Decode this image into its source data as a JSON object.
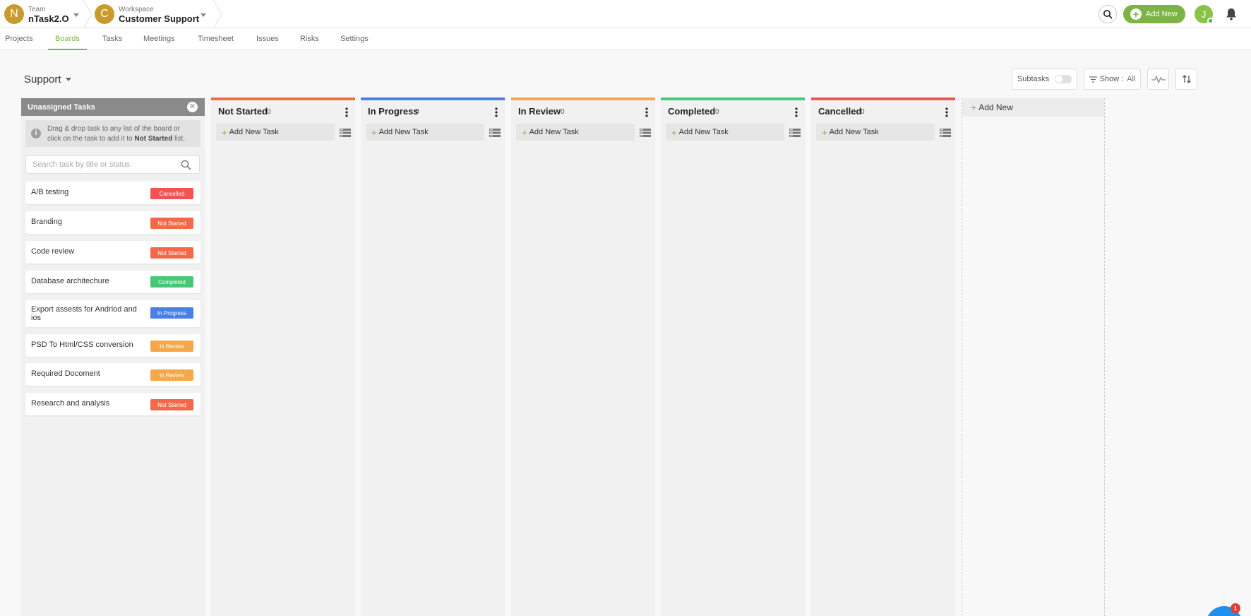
{
  "header": {
    "team": {
      "initial": "N",
      "caption": "Team",
      "name": "nTask2.O"
    },
    "workspace": {
      "initial": "C",
      "caption": "Workspace",
      "name": "Customer Support"
    },
    "add_new_label": "Add New",
    "user_initial": "J",
    "colors": {
      "accent": "#7cb342",
      "team_avatar": "#c99a2e"
    }
  },
  "nav": {
    "tabs": [
      {
        "label": "Projects"
      },
      {
        "label": "Boards",
        "active": true
      },
      {
        "label": "Tasks"
      },
      {
        "label": "Meetings"
      },
      {
        "label": "Timesheet"
      },
      {
        "label": "Issues"
      },
      {
        "label": "Risks"
      },
      {
        "label": "Settings"
      }
    ]
  },
  "board": {
    "title": "Support",
    "subtasks_label": "Subtasks",
    "show_label": "Show :",
    "show_value": "All"
  },
  "unassigned": {
    "title": "Unassigned Tasks",
    "info_line1": "Drag & drop task to any list of the board or",
    "info_line2_prefix": "click on the task to add it to",
    "info_line2_bold": "Not Started",
    "info_line2_suffix": "list.",
    "search_placeholder": "Search task by title or status.",
    "tasks": [
      {
        "title": "A/B testing",
        "status": "Cancelled",
        "color": "#f05454"
      },
      {
        "title": "Branding",
        "status": "Not Started",
        "color": "#f5694a"
      },
      {
        "title": "Code review",
        "status": "Not Started",
        "color": "#f5694a"
      },
      {
        "title": "Database architechure",
        "status": "Completed",
        "color": "#48c774"
      },
      {
        "title": "Export assests for Andriod and ios",
        "status": "In Progress",
        "color": "#4a7fe8"
      },
      {
        "title": "PSD To Html/CSS conversion",
        "status": "In Review",
        "color": "#f5a84a"
      },
      {
        "title": "Required Docoment",
        "status": "In Review",
        "color": "#f5a84a"
      },
      {
        "title": "Research and analysis",
        "status": "Not Started",
        "color": "#f5694a"
      }
    ]
  },
  "columns": [
    {
      "name": "Not Started",
      "count": "0",
      "color": "#f5694a",
      "add_label": "Add New Task"
    },
    {
      "name": "In Progress",
      "count": "0",
      "color": "#4a7fe8",
      "add_label": "Add New Task"
    },
    {
      "name": "In Review",
      "count": "0",
      "color": "#f5a84a",
      "add_label": "Add New Task"
    },
    {
      "name": "Completed",
      "count": "0",
      "color": "#48c774",
      "add_label": "Add New Task"
    },
    {
      "name": "Cancelled",
      "count": "0",
      "color": "#f05454",
      "add_label": "Add New Task"
    }
  ],
  "add_list_label": "Add New",
  "chat": {
    "badge": "1"
  }
}
